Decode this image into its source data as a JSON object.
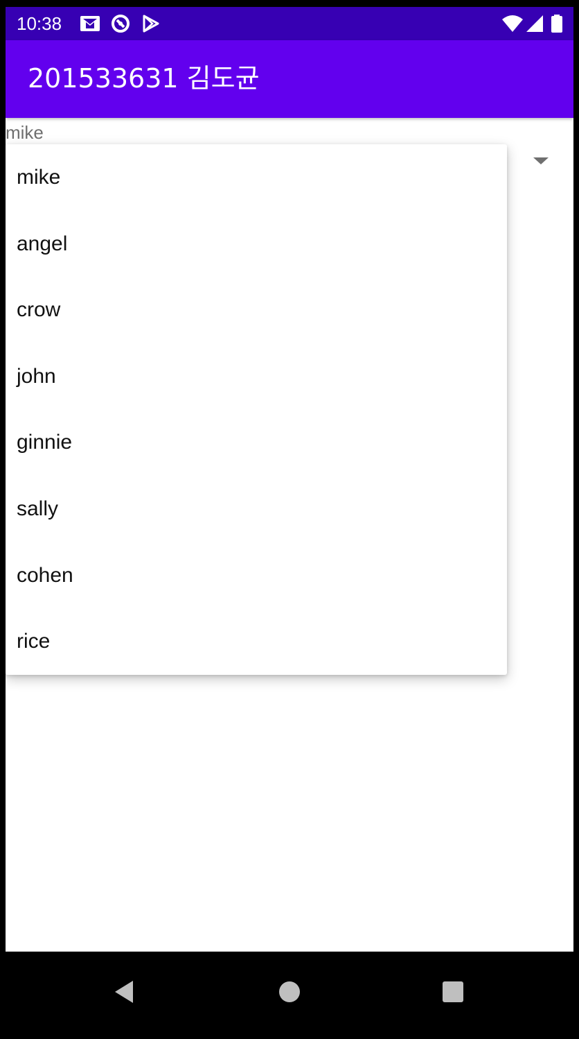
{
  "status_bar": {
    "time": "10:38",
    "icons": [
      "gmail-icon",
      "sync-icon",
      "play-store-icon",
      "wifi-icon",
      "signal-icon",
      "battery-icon"
    ]
  },
  "app_bar": {
    "title": "201533631 김도균"
  },
  "spinner": {
    "selected_value": "mike",
    "options": [
      "mike",
      "angel",
      "crow",
      "john",
      "ginnie",
      "sally",
      "cohen",
      "rice"
    ]
  },
  "nav_bar": {
    "buttons": [
      "back-icon",
      "home-icon",
      "recents-icon"
    ]
  },
  "colors": {
    "status_bar": "#3700b3",
    "app_bar": "#6200ee",
    "background": "#ffffff"
  }
}
